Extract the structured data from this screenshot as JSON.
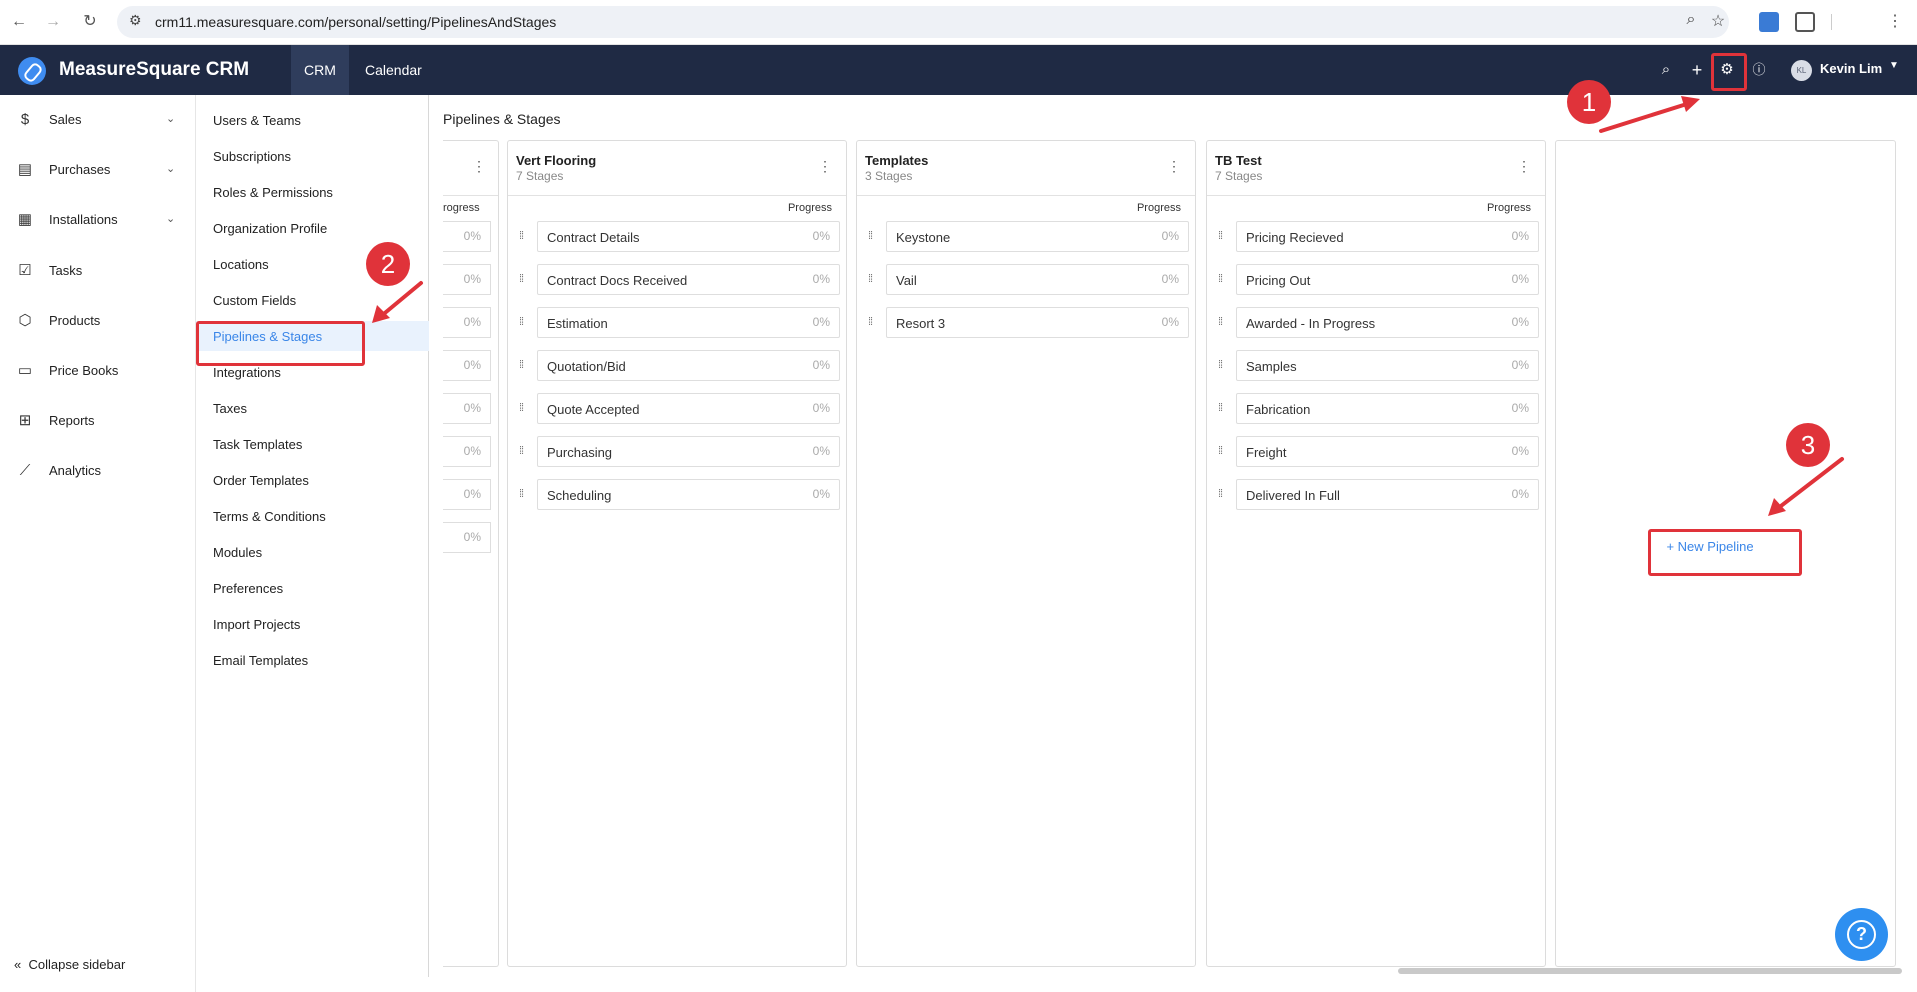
{
  "browser": {
    "url": "crm11.measuresquare.com/personal/setting/PipelinesAndStages"
  },
  "header": {
    "app_title": "MeasureSquare CRM",
    "tabs": [
      {
        "label": "CRM",
        "active": true
      },
      {
        "label": "Calendar",
        "active": false
      }
    ],
    "user": {
      "initials": "KL",
      "name": "Kevin Lim"
    }
  },
  "sidebar": {
    "items": [
      {
        "label": "Sales",
        "icon": "dollar-icon",
        "expandable": true
      },
      {
        "label": "Purchases",
        "icon": "receipt-icon",
        "expandable": true
      },
      {
        "label": "Installations",
        "icon": "install-icon",
        "expandable": true
      },
      {
        "label": "Tasks",
        "icon": "checklist-icon",
        "expandable": false
      },
      {
        "label": "Products",
        "icon": "cube-icon",
        "expandable": false
      },
      {
        "label": "Price Books",
        "icon": "book-icon",
        "expandable": false
      },
      {
        "label": "Reports",
        "icon": "presentation-icon",
        "expandable": false
      },
      {
        "label": "Analytics",
        "icon": "chart-line-icon",
        "expandable": false
      }
    ],
    "collapse_label": "Collapse sidebar"
  },
  "settings_nav": {
    "items": [
      "Users & Teams",
      "Subscriptions",
      "Roles & Permissions",
      "Organization Profile",
      "Locations",
      "Custom Fields",
      "Pipelines & Stages",
      "Integrations",
      "Taxes",
      "Task Templates",
      "Order Templates",
      "Terms & Conditions",
      "Modules",
      "Preferences",
      "Import Projects",
      "Email Templates"
    ],
    "active": "Pipelines & Stages"
  },
  "main": {
    "title": "Pipelines & Stages",
    "progress_header": "Progress",
    "partial_column": {
      "progress_header_fragment": "rogress",
      "values": [
        "0%",
        "0%",
        "0%",
        "0%",
        "0%",
        "0%",
        "0%",
        "0%"
      ]
    },
    "pipelines": [
      {
        "name": "Vert Flooring",
        "stage_count": "7 Stages",
        "stages": [
          {
            "name": "Contract Details",
            "progress": "0%"
          },
          {
            "name": "Contract Docs Received",
            "progress": "0%"
          },
          {
            "name": "Estimation",
            "progress": "0%"
          },
          {
            "name": "Quotation/Bid",
            "progress": "0%"
          },
          {
            "name": "Quote Accepted",
            "progress": "0%"
          },
          {
            "name": "Purchasing",
            "progress": "0%"
          },
          {
            "name": "Scheduling",
            "progress": "0%"
          }
        ]
      },
      {
        "name": "Templates",
        "stage_count": "3 Stages",
        "stages": [
          {
            "name": "Keystone",
            "progress": "0%"
          },
          {
            "name": "Vail",
            "progress": "0%"
          },
          {
            "name": "Resort 3",
            "progress": "0%"
          }
        ]
      },
      {
        "name": "TB Test",
        "stage_count": "7 Stages",
        "stages": [
          {
            "name": "Pricing Recieved",
            "progress": "0%"
          },
          {
            "name": "Pricing Out",
            "progress": "0%"
          },
          {
            "name": "Awarded - In Progress",
            "progress": "0%"
          },
          {
            "name": "Samples",
            "progress": "0%"
          },
          {
            "name": "Fabrication",
            "progress": "0%"
          },
          {
            "name": "Freight",
            "progress": "0%"
          },
          {
            "name": "Delivered In Full",
            "progress": "0%"
          }
        ]
      }
    ],
    "new_pipeline_label": "New Pipeline"
  },
  "annotations": {
    "markers": [
      "1",
      "2",
      "3"
    ],
    "color": "#e0333a"
  },
  "colors": {
    "header_bg": "#1f2a44",
    "accent": "#3a86e8"
  }
}
